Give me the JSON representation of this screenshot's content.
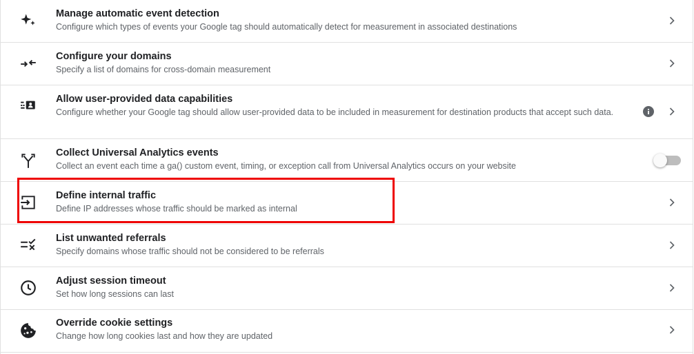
{
  "settings": {
    "items": [
      {
        "icon": "auto-detect-sparkle-icon",
        "title": "Manage automatic event detection",
        "description": "Configure which types of events your Google tag should automatically detect for measurement in associated destinations"
      },
      {
        "icon": "cross-domain-arrows-icon",
        "title": "Configure your domains",
        "description": "Specify a list of domains for cross-domain measurement"
      },
      {
        "icon": "user-data-list-icon",
        "title": "Allow user-provided data capabilities",
        "description": "Configure whether your Google tag should allow user-provided data to be included in measurement for destination products that accept such data."
      },
      {
        "icon": "merge-arrow-icon",
        "title": "Collect Universal Analytics events",
        "description": "Collect an event each time a ga() custom event, timing, or exception call from Universal Analytics occurs on your website",
        "toggle_on": false
      },
      {
        "icon": "login-arrow-icon",
        "title": "Define internal traffic",
        "description": "Define IP addresses whose traffic should be marked as internal",
        "highlighted": true
      },
      {
        "icon": "checklist-x-icon",
        "title": "List unwanted referrals",
        "description": "Specify domains whose traffic should not be considered to be referrals"
      },
      {
        "icon": "clock-icon",
        "title": "Adjust session timeout",
        "description": "Set how long sessions can last"
      },
      {
        "icon": "cookie-icon",
        "title": "Override cookie settings",
        "description": "Change how long cookies last and how they are updated"
      }
    ]
  },
  "colors": {
    "highlight_border": "#ee0000",
    "icon": "#5f6368",
    "title": "#202124",
    "description": "#5f6368",
    "divider": "#e0e0e0"
  }
}
